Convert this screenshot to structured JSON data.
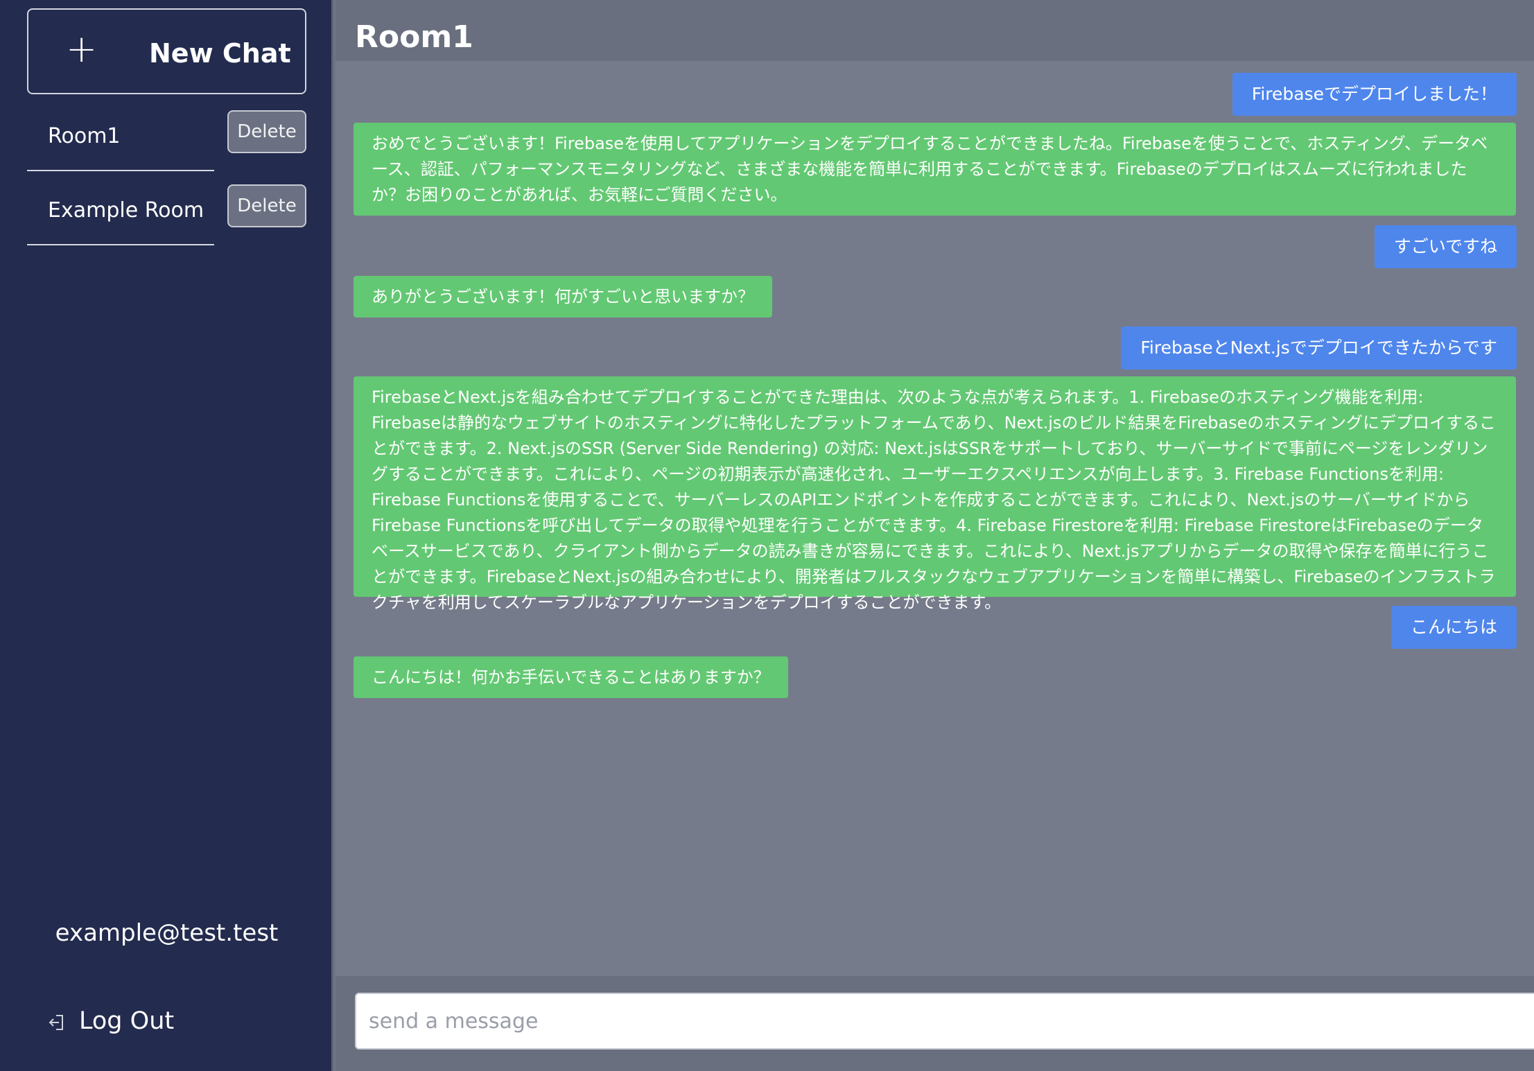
{
  "sidebar": {
    "new_chat_label": "New Chat",
    "rooms": [
      {
        "name": "Room1",
        "delete_label": "Delete"
      },
      {
        "name": "Example Room",
        "delete_label": "Delete"
      }
    ],
    "user_email": "example@test.test",
    "logout_label": "Log Out"
  },
  "main": {
    "room_title": "Room1",
    "messages": [
      {
        "role": "user",
        "text": "Firebaseでデプロイしました！"
      },
      {
        "role": "bot",
        "text": "おめでとうございます！Firebaseを使用してアプリケーションをデプロイすることができましたね。Firebaseを使うことで、ホスティング、データベース、認証、パフォーマンスモニタリングなど、さまざまな機能を簡単に利用することができます。Firebaseのデプロイはスムーズに行われましたか？お困りのことがあれば、お気軽にご質問ください。"
      },
      {
        "role": "user",
        "text": "すごいですね"
      },
      {
        "role": "bot",
        "text": "ありがとうございます！何がすごいと思いますか？"
      },
      {
        "role": "user",
        "text": "FirebaseとNext.jsでデプロイできたからです"
      },
      {
        "role": "bot",
        "text": "FirebaseとNext.jsを組み合わせてデプロイすることができた理由は、次のような点が考えられます。1. Firebaseのホスティング機能を利用: Firebaseは静的なウェブサイトのホスティングに特化したプラットフォームであり、Next.jsのビルド結果をFirebaseのホスティングにデプロイすることができます。2. Next.jsのSSR (Server Side Rendering) の対応: Next.jsはSSRをサポートしており、サーバーサイドで事前にページをレンダリングすることができます。これにより、ページの初期表示が高速化され、ユーザーエクスペリエンスが向上します。3. Firebase Functionsを利用: Firebase Functionsを使用することで、サーバーレスのAPIエンドポイントを作成することができます。これにより、Next.jsのサーバーサイドからFirebase Functionsを呼び出してデータの取得や処理を行うことができます。4. Firebase Firestoreを利用: Firebase FirestoreはFirebaseのデータベースサービスであり、クライアント側からデータの読み書きが容易にできます。これにより、Next.jsアプリからデータの取得や保存を簡単に行うことができます。FirebaseとNext.jsの組み合わせにより、開発者はフルスタックなウェブアプリケーションを簡単に構築し、Firebaseのインフラストラクチャを利用してスケーラブルなアプリケーションをデプロイすることができます。"
      },
      {
        "role": "user",
        "text": "こんにちは"
      },
      {
        "role": "bot",
        "text": "こんにちは！何かお手伝いできることはありますか？"
      }
    ],
    "composer": {
      "placeholder": "send a message",
      "value": ""
    }
  },
  "colors": {
    "sidebar_bg": "#232b4e",
    "main_bg": "#767b8b",
    "user_bubble": "#4f86ec",
    "bot_bubble": "#63c873"
  },
  "icons": [
    "plus-icon",
    "logout-icon"
  ]
}
